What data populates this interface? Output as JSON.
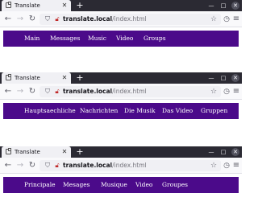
{
  "browser": {
    "tab_title": "Translate",
    "tab_close": "✕",
    "new_tab": "+",
    "url_host": "translate.local",
    "url_path": "/index.html",
    "icons": {
      "back": "back-arrow-icon",
      "forward": "forward-arrow-icon",
      "reload": "reload-icon",
      "shield": "shield-icon",
      "lock": "lock-icon",
      "bookmark": "star-icon",
      "extensions": "extensions-icon",
      "menu": "hamburger-menu-icon",
      "minimize": "minimize-icon",
      "maximize": "maximize-icon",
      "close": "close-icon"
    }
  },
  "colors": {
    "nav_background": "#4b0a8a",
    "nav_text": "#ffffff",
    "tabbar": "#2b2a33"
  },
  "windows": [
    {
      "language": "en",
      "nav": [
        "Main",
        "Messages",
        "Music",
        "Video",
        "Groups"
      ]
    },
    {
      "language": "de",
      "nav": [
        "Hauptsaechliche",
        "Nachrichten",
        "Die Musik",
        "Das Video",
        "Gruppen"
      ]
    },
    {
      "language": "es",
      "nav": [
        "Principale",
        "Mesages",
        "Musique",
        "Video",
        "Groupes"
      ]
    }
  ]
}
